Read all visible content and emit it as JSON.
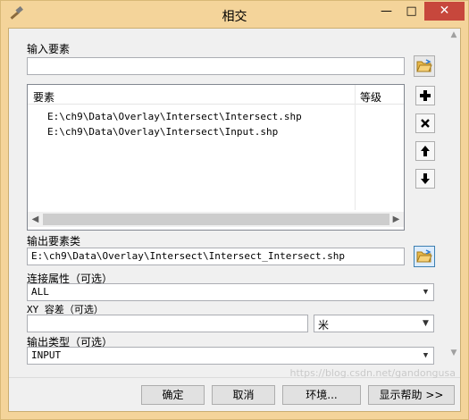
{
  "window": {
    "title": "相交",
    "minimize": "—",
    "maximize": "□",
    "close": "✕"
  },
  "input_features": {
    "label": "输入要素",
    "value": "",
    "table": {
      "col_features": "要素",
      "col_rank": "等级",
      "rows": [
        {
          "path": "E:\\ch9\\Data\\Overlay\\Intersect\\Intersect.shp",
          "rank": ""
        },
        {
          "path": "E:\\ch9\\Data\\Overlay\\Intersect\\Input.shp",
          "rank": ""
        }
      ]
    },
    "side_buttons": [
      "add",
      "remove",
      "move-up",
      "move-down"
    ]
  },
  "output_feature_class": {
    "label": "输出要素类",
    "value": "E:\\ch9\\Data\\Overlay\\Intersect\\Intersect_Intersect.shp"
  },
  "join_attributes": {
    "label": "连接属性（可选）",
    "value": "ALL"
  },
  "xy_tolerance": {
    "label": "XY 容差（可选）",
    "value": "",
    "unit": "米"
  },
  "output_type": {
    "label": "输出类型（可选）",
    "value": "INPUT"
  },
  "buttons": {
    "ok": "确定",
    "cancel": "取消",
    "environments": "环境...",
    "show_help": "显示帮助 >>"
  },
  "watermark": "https://blog.csdn.net/gandongusa",
  "colors": {
    "window_frame": "#f4d49a",
    "close_button": "#c7473c"
  }
}
